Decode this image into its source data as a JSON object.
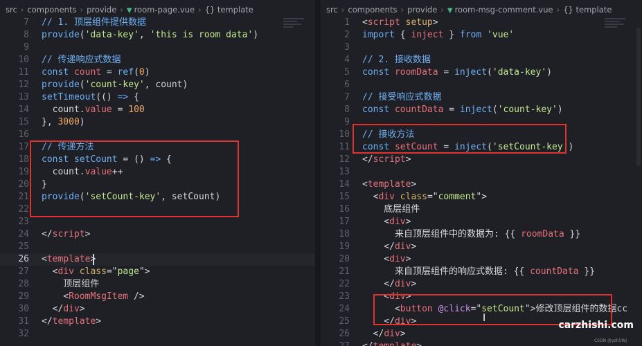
{
  "left": {
    "breadcrumb": [
      "src",
      "components",
      "provide",
      "room-page.vue",
      "{} template"
    ],
    "lines": [
      {
        "n": "7",
        "t": [
          [
            "c-comment",
            "// 1. 顶层组件提供数据"
          ]
        ]
      },
      {
        "n": "8",
        "t": [
          [
            "c-fn",
            "provide"
          ],
          [
            "c-punc",
            "("
          ],
          [
            "c-str",
            "'data-key'"
          ],
          [
            "c-punc",
            ", "
          ],
          [
            "c-str",
            "'this is room data'"
          ],
          [
            "c-punc",
            ")"
          ]
        ]
      },
      {
        "n": "9",
        "t": []
      },
      {
        "n": "10",
        "t": [
          [
            "c-comment",
            "// 传递响应式数据"
          ]
        ]
      },
      {
        "n": "11",
        "t": [
          [
            "c-kw",
            "const "
          ],
          [
            "c-var",
            "count"
          ],
          [
            "c-punc",
            " = "
          ],
          [
            "c-fn",
            "ref"
          ],
          [
            "c-punc",
            "("
          ],
          [
            "c-num",
            "0"
          ],
          [
            "c-punc",
            ")"
          ]
        ]
      },
      {
        "n": "12",
        "t": [
          [
            "c-fn",
            "provide"
          ],
          [
            "c-punc",
            "("
          ],
          [
            "c-str",
            "'count-key'"
          ],
          [
            "c-punc",
            ", count)"
          ]
        ]
      },
      {
        "n": "13",
        "t": [
          [
            "c-fn",
            "setTimeout"
          ],
          [
            "c-punc",
            "(() "
          ],
          [
            "c-kw",
            "=>"
          ],
          [
            "c-punc",
            " {"
          ]
        ]
      },
      {
        "n": "14",
        "t": [
          [
            "c-punc",
            "  count."
          ],
          [
            "c-var",
            "value"
          ],
          [
            "c-punc",
            " = "
          ],
          [
            "c-num",
            "100"
          ]
        ]
      },
      {
        "n": "15",
        "t": [
          [
            "c-punc",
            "}, "
          ],
          [
            "c-num",
            "3000"
          ],
          [
            "c-punc",
            ")"
          ]
        ]
      },
      {
        "n": "16",
        "t": []
      },
      {
        "n": "17",
        "t": [
          [
            "c-comment",
            "// 传递方法"
          ]
        ]
      },
      {
        "n": "18",
        "t": [
          [
            "c-kw",
            "const "
          ],
          [
            "c-fn",
            "setCount"
          ],
          [
            "c-punc",
            " = () "
          ],
          [
            "c-kw",
            "=>"
          ],
          [
            "c-punc",
            " {"
          ]
        ]
      },
      {
        "n": "19",
        "t": [
          [
            "c-punc",
            "  count."
          ],
          [
            "c-var",
            "value"
          ],
          [
            "c-punc",
            "++"
          ]
        ]
      },
      {
        "n": "20",
        "t": [
          [
            "c-punc",
            "}"
          ]
        ]
      },
      {
        "n": "21",
        "t": [
          [
            "c-fn",
            "provide"
          ],
          [
            "c-punc",
            "("
          ],
          [
            "c-str",
            "'setCount-key'"
          ],
          [
            "c-punc",
            ", setCount)"
          ]
        ]
      },
      {
        "n": "22",
        "t": []
      },
      {
        "n": "23",
        "t": []
      },
      {
        "n": "24",
        "t": [
          [
            "c-punc",
            "</"
          ],
          [
            "c-tag",
            "script"
          ],
          [
            "c-punc",
            ">"
          ]
        ]
      },
      {
        "n": "25",
        "t": []
      },
      {
        "n": "26",
        "t": [
          [
            "c-punc",
            "<"
          ],
          [
            "c-tag",
            "template"
          ],
          [
            "c-punc",
            ">"
          ]
        ],
        "active": true
      },
      {
        "n": "27",
        "t": [
          [
            "c-punc",
            "  <"
          ],
          [
            "c-tag",
            "div"
          ],
          [
            "c-attr",
            " class"
          ],
          [
            "c-punc",
            "=\""
          ],
          [
            "c-str",
            "page"
          ],
          [
            "c-punc",
            "\">"
          ]
        ]
      },
      {
        "n": "28",
        "t": [
          [
            "c-text",
            "    顶层组件"
          ]
        ]
      },
      {
        "n": "29",
        "t": [
          [
            "c-punc",
            "    <"
          ],
          [
            "c-tag",
            "RoomMsgItem"
          ],
          [
            "c-punc",
            " />"
          ]
        ]
      },
      {
        "n": "30",
        "t": [
          [
            "c-punc",
            "  </"
          ],
          [
            "c-tag",
            "div"
          ],
          [
            "c-punc",
            ">"
          ]
        ]
      },
      {
        "n": "31",
        "t": [
          [
            "c-punc",
            "</"
          ],
          [
            "c-tag",
            "template"
          ],
          [
            "c-punc",
            ">"
          ]
        ]
      },
      {
        "n": "32",
        "t": []
      }
    ]
  },
  "right": {
    "breadcrumb": [
      "src",
      "components",
      "provide",
      "room-msg-comment.vue",
      "{} template"
    ],
    "lines": [
      {
        "n": "1",
        "t": [
          [
            "c-punc",
            "<"
          ],
          [
            "c-tag",
            "script"
          ],
          [
            "c-attr",
            " setup"
          ],
          [
            "c-punc",
            ">"
          ]
        ]
      },
      {
        "n": "2",
        "t": [
          [
            "c-kw",
            "import"
          ],
          [
            "c-punc",
            " { "
          ],
          [
            "c-var",
            "inject"
          ],
          [
            "c-punc",
            " } "
          ],
          [
            "c-kw",
            "from "
          ],
          [
            "c-str",
            "'vue'"
          ]
        ]
      },
      {
        "n": "3",
        "t": []
      },
      {
        "n": "4",
        "t": [
          [
            "c-comment",
            "// 2. 接收数据"
          ]
        ]
      },
      {
        "n": "5",
        "t": [
          [
            "c-kw",
            "const "
          ],
          [
            "c-var",
            "roomData"
          ],
          [
            "c-punc",
            " = "
          ],
          [
            "c-fn",
            "inject"
          ],
          [
            "c-punc",
            "("
          ],
          [
            "c-str",
            "'data-key'"
          ],
          [
            "c-punc",
            ")"
          ]
        ]
      },
      {
        "n": "6",
        "t": []
      },
      {
        "n": "7",
        "t": [
          [
            "c-comment",
            "// 接受响应式数据"
          ]
        ]
      },
      {
        "n": "8",
        "t": [
          [
            "c-kw",
            "const "
          ],
          [
            "c-var",
            "countData"
          ],
          [
            "c-punc",
            " = "
          ],
          [
            "c-fn",
            "inject"
          ],
          [
            "c-punc",
            "("
          ],
          [
            "c-str",
            "'count-key'"
          ],
          [
            "c-punc",
            ")"
          ]
        ]
      },
      {
        "n": "9",
        "t": []
      },
      {
        "n": "10",
        "t": [
          [
            "c-comment",
            "// 接收方法"
          ]
        ]
      },
      {
        "n": "11",
        "t": [
          [
            "c-kw",
            "const "
          ],
          [
            "c-var",
            "setCount"
          ],
          [
            "c-punc",
            " = "
          ],
          [
            "c-fn",
            "inject"
          ],
          [
            "c-punc",
            "("
          ],
          [
            "c-str",
            "'setCount-key'"
          ],
          [
            "c-punc",
            ")"
          ]
        ]
      },
      {
        "n": "12",
        "t": [
          [
            "c-punc",
            "</"
          ],
          [
            "c-tag",
            "script"
          ],
          [
            "c-punc",
            ">"
          ]
        ]
      },
      {
        "n": "13",
        "t": []
      },
      {
        "n": "14",
        "t": [
          [
            "c-punc",
            "<"
          ],
          [
            "c-tag",
            "template"
          ],
          [
            "c-punc",
            ">"
          ]
        ]
      },
      {
        "n": "15",
        "t": [
          [
            "c-punc",
            "  <"
          ],
          [
            "c-tag",
            "div"
          ],
          [
            "c-attr",
            " class"
          ],
          [
            "c-punc",
            "=\""
          ],
          [
            "c-str",
            "comment"
          ],
          [
            "c-punc",
            "\">"
          ]
        ]
      },
      {
        "n": "16",
        "t": [
          [
            "c-text",
            "    底层组件"
          ]
        ]
      },
      {
        "n": "17",
        "t": [
          [
            "c-punc",
            "    <"
          ],
          [
            "c-tag",
            "div"
          ],
          [
            "c-punc",
            ">"
          ]
        ]
      },
      {
        "n": "18",
        "t": [
          [
            "c-text",
            "      来自顶层组件中的数据为: {{ "
          ],
          [
            "c-var",
            "roomData"
          ],
          [
            "c-text",
            " }}"
          ]
        ]
      },
      {
        "n": "19",
        "t": [
          [
            "c-punc",
            "    </"
          ],
          [
            "c-tag",
            "div"
          ],
          [
            "c-punc",
            ">"
          ]
        ]
      },
      {
        "n": "20",
        "t": [
          [
            "c-punc",
            "    <"
          ],
          [
            "c-tag",
            "div"
          ],
          [
            "c-punc",
            ">"
          ]
        ]
      },
      {
        "n": "21",
        "t": [
          [
            "c-text",
            "      来自顶层组件的响应式数据: {{ "
          ],
          [
            "c-var",
            "countData"
          ],
          [
            "c-text",
            " }}"
          ]
        ]
      },
      {
        "n": "22",
        "t": [
          [
            "c-punc",
            "    </"
          ],
          [
            "c-tag",
            "div"
          ],
          [
            "c-punc",
            ">"
          ]
        ]
      },
      {
        "n": "23",
        "t": [
          [
            "c-punc",
            "    <"
          ],
          [
            "c-tag",
            "div"
          ],
          [
            "c-punc",
            ">"
          ]
        ]
      },
      {
        "n": "24",
        "t": [
          [
            "c-punc",
            "      <"
          ],
          [
            "c-tag",
            "button"
          ],
          [
            "c-ev",
            " @click"
          ],
          [
            "c-punc",
            "=\""
          ],
          [
            "c-str",
            "setCount"
          ],
          [
            "c-punc",
            "\">"
          ],
          [
            "c-text",
            "修改顶层组件的数据cc"
          ]
        ]
      },
      {
        "n": "25",
        "t": [
          [
            "c-punc",
            "    </"
          ],
          [
            "c-tag",
            "div"
          ],
          [
            "c-punc",
            ">"
          ]
        ]
      },
      {
        "n": "26",
        "t": [
          [
            "c-punc",
            "  </"
          ],
          [
            "c-tag",
            "div"
          ],
          [
            "c-punc",
            ">"
          ]
        ]
      },
      {
        "n": "27",
        "t": [
          [
            "c-punc",
            "</"
          ],
          [
            "c-tag",
            "template"
          ],
          [
            "c-punc",
            ">"
          ]
        ]
      }
    ]
  },
  "watermark": {
    "brand": "carzhishi.com",
    "small": "CSDN @yzh5WJ"
  }
}
